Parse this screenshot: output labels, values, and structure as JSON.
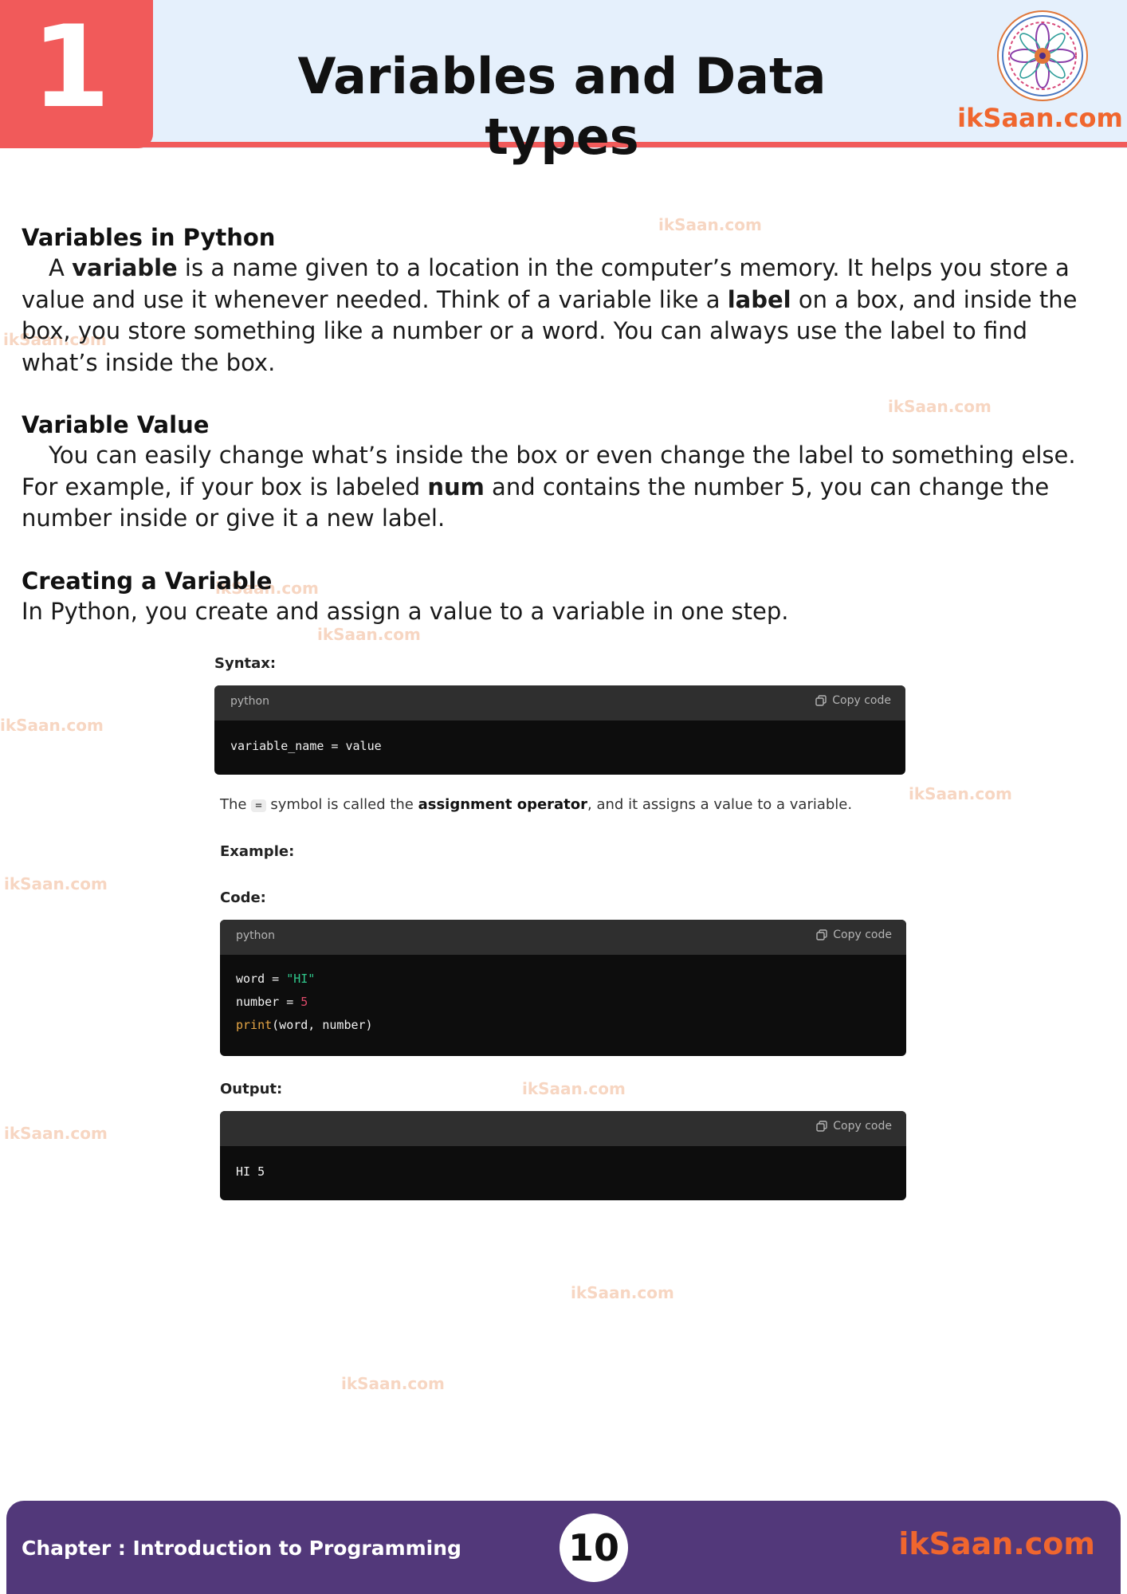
{
  "header": {
    "chapter_number": "1",
    "title": "Variables and Data types",
    "brand": "ikSaan.com"
  },
  "watermark": "ikSaan.com",
  "sections": {
    "variables_heading": "Variables in Python",
    "variables_p_1": "A ",
    "variables_p_b1": "variable",
    "variables_p_2": " is a name given to a location in the computer’s memory. It helps you store a value and use it whenever needed. Think of a variable like a ",
    "variables_p_b2": "label",
    "variables_p_3": " on a box, and inside the box, you store something like a number or a word. You can always use the label to find what’s inside the box.",
    "value_heading": "Variable Value",
    "value_p_1": "You can easily change what’s inside the box or even change the label to something else. For example, if your box is labeled ",
    "value_p_b1": "num",
    "value_p_2": " and contains the number 5, you can change the number inside or give it a new label.",
    "creating_heading": "Creating a Variable",
    "creating_p": "In Python, you create and assign a value to a variable in one step."
  },
  "syntax": {
    "label": "Syntax:",
    "lang": "python",
    "copy": "Copy code",
    "code": "variable_name = value"
  },
  "assign_note": {
    "part1": "The ",
    "operator": "=",
    "part2": " symbol is called the ",
    "bold": "assignment operator",
    "part3": ", and it assigns a value to a variable."
  },
  "example_label": "Example:",
  "code_block": {
    "label": "Code:",
    "lang": "python",
    "copy": "Copy code",
    "line1_var": "word",
    "line1_op": " = ",
    "line1_val": "\"HI\"",
    "line2_var": "number",
    "line2_op": " = ",
    "line2_val": "5",
    "line3_fn": "print",
    "line3_args": "(word, number)"
  },
  "output_block": {
    "label": "Output:",
    "copy": "Copy code",
    "code": "HI 5"
  },
  "footer": {
    "chapter": "Chapter : Introduction to Programming",
    "page": "10",
    "brand": "ikSaan.com"
  },
  "colors": {
    "accent_red": "#f15a5a",
    "header_bg": "#e5f0fc",
    "footer_purple": "#52387a",
    "brand_orange": "#f0662e"
  }
}
